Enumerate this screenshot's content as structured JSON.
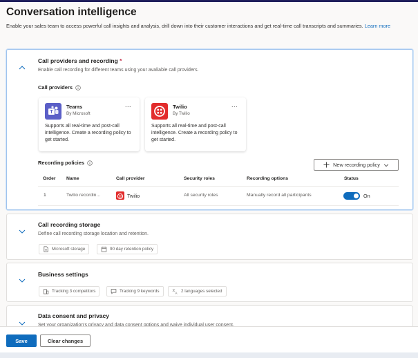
{
  "page": {
    "title": "Conversation intelligence",
    "description": "Enable your sales team to access powerful call insights and analysis, drill down into their  customer interactions and get real-time call transcripts and summaries.",
    "learn_more": "Learn more"
  },
  "call_providers_section": {
    "title": "Call providers and recording",
    "required_mark": "*",
    "description": "Enable call recording for different teams using your avaliable call providers.",
    "providers_label": "Call providers",
    "providers": [
      {
        "name": "Teams",
        "by": "By Microsoft",
        "more": "...",
        "description": "Supports all real-time and post-call intelligence. Create a recording policy to get started."
      },
      {
        "name": "Twilio",
        "by": "By Twilio",
        "more": "...",
        "description": "Supports all real-time and post-call intelligence. Create a recording policy to get started."
      }
    ],
    "policies_label": "Recording policies",
    "new_policy_button": "New recording policy",
    "table": {
      "headers": [
        "Order",
        "Name",
        "Call provider",
        "Security roles",
        "Recording options",
        "Status"
      ],
      "rows": [
        {
          "order": "1",
          "name": "Twilio recordin...",
          "provider": "Twilio",
          "roles": "All security roles",
          "options": "Manually record all participants",
          "status": "On"
        }
      ]
    }
  },
  "storage_section": {
    "title": "Call recording storage",
    "description": "Define call recording storage location and retention.",
    "chips": [
      "Microsoft storage",
      "90 day retention policy"
    ]
  },
  "business_section": {
    "title": "Business settings",
    "chips": [
      "Tracking 3 competitors",
      "Tracking 9 keywords",
      "2 languages selected"
    ]
  },
  "consent_section": {
    "title": "Data consent and privacy",
    "description": "Set your organization's privacy and data consent options and waive individual user consent."
  },
  "footer": {
    "save": "Save",
    "clear": "Clear changes"
  },
  "colors": {
    "accent": "#0f6cbd",
    "teams": "#5b5fc7",
    "twilio": "#e22c2c"
  }
}
